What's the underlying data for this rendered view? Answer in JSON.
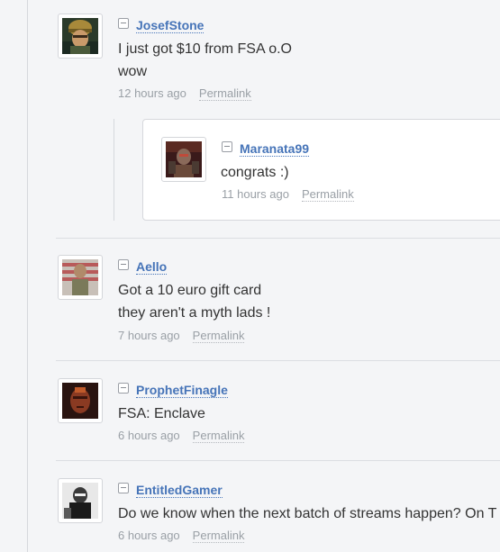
{
  "comments": [
    {
      "author": "JosefStone",
      "lines": [
        "I just got $10 from FSA o.O",
        "wow"
      ],
      "time": "12 hours ago",
      "permalink": "Permalink",
      "avatar": "helmeted-soldier-avatar"
    },
    {
      "author": "Maranata99",
      "lines": [
        "congrats :)"
      ],
      "time": "11 hours ago",
      "permalink": "Permalink",
      "avatar": "armored-figure-avatar"
    },
    {
      "author": "Aello",
      "lines": [
        "Got a 10 euro gift card",
        "they aren't a myth lads !"
      ],
      "time": "7 hours ago",
      "permalink": "Permalink",
      "avatar": "soldier-flag-avatar"
    },
    {
      "author": "ProphetFinagle",
      "lines": [
        "FSA: Enclave"
      ],
      "time": "6 hours ago",
      "permalink": "Permalink",
      "avatar": "red-face-avatar"
    },
    {
      "author": "EntitledGamer",
      "lines": [
        "Do we know when the next batch of streams happen? On T"
      ],
      "time": "6 hours ago",
      "permalink": "Permalink",
      "avatar": "bw-soldier-avatar"
    }
  ]
}
